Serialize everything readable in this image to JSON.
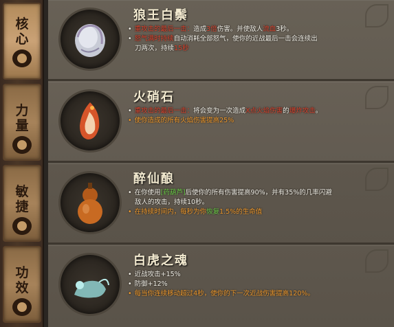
{
  "tabs": [
    {
      "label": [
        "核",
        "心"
      ],
      "icon": "swirl-emblem-icon",
      "active": true
    },
    {
      "label": [
        "力",
        "量"
      ],
      "icon": "fist-emblem-icon",
      "active": false
    },
    {
      "label": [
        "敏",
        "捷"
      ],
      "icon": "dash-emblem-icon",
      "active": false
    },
    {
      "label": [
        "功",
        "效"
      ],
      "icon": "leaf-emblem-icon",
      "active": false
    }
  ],
  "items": [
    {
      "title": "狼王白鬃",
      "icon": "white-mane-fur-icon",
      "lines": [
        {
          "bullet": "•",
          "a": "重攻击的最后一击：",
          "b": "造成",
          "c": "3倍",
          "d": "伤害。并使敌人",
          "e": "流血",
          "f": "3秒。"
        },
        {
          "bullet": "•",
          "a": "怒气满时持续",
          "b": "自动消耗全部怒气，使你的近战最后一击会连续出"
        },
        {
          "cont": "刀两次，持续",
          "val": "15秒"
        }
      ]
    },
    {
      "title": "火硝石",
      "icon": "fire-stone-icon",
      "lines": [
        {
          "bullet": "•",
          "a": "重攻击的最后一击：",
          "b": "将会变为一次造成",
          "c": "X点",
          "d": "火焰伤害",
          "e": "的",
          "f": "爆炸攻击",
          "g": "。"
        },
        {
          "bullet": "•",
          "a": "使你造成的所有火焰伤害提高25%"
        }
      ]
    },
    {
      "title": "醉仙酿",
      "icon": "gourd-icon",
      "lines": [
        {
          "bullet": "•",
          "a": "在你使用",
          "b": "[药葫芦]",
          "c": "后使你的所有伤害提高90%，并有35%的几率闪避"
        },
        {
          "cont": "敌人的攻击，持续10秒。"
        },
        {
          "bullet": "•",
          "a": "在持续时间内，每秒为你",
          "b": "恢复",
          "c": "1.5%的生命值"
        }
      ]
    },
    {
      "title": "白虎之魂",
      "icon": "white-tiger-spirit-icon",
      "lines": [
        {
          "bullet": "•",
          "a": "近战攻击+15%"
        },
        {
          "bullet": "•",
          "a": "防御+12%"
        },
        {
          "bullet": "•",
          "a": "每当你连续移动超过4秒，使你的下一次近战伤害提高120%。"
        }
      ]
    }
  ]
}
